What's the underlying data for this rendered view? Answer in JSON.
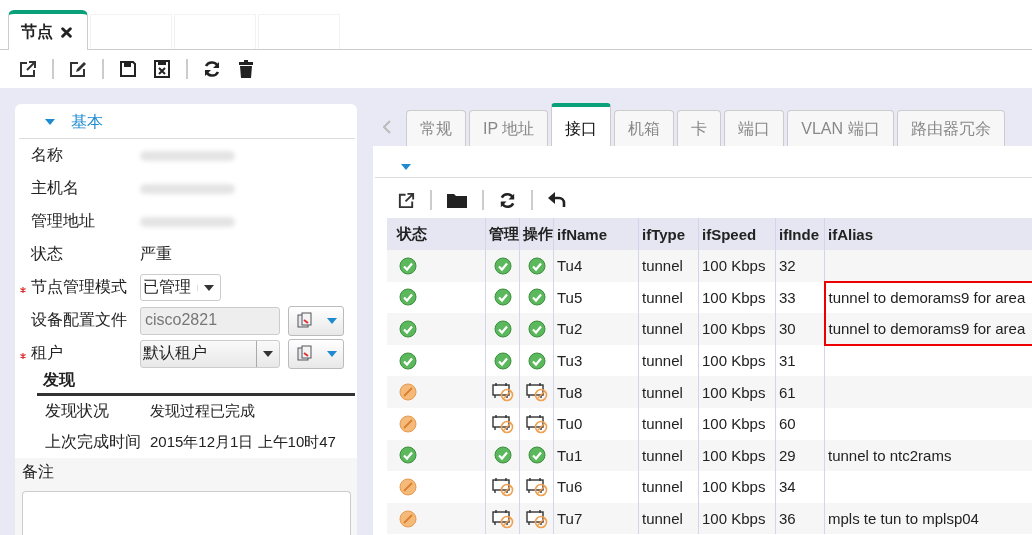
{
  "node_tab": {
    "label": "节点",
    "selected": true
  },
  "basic_section": {
    "title": "基本",
    "expanded": true
  },
  "fields": [
    {
      "kind": "redacted",
      "label": "名称",
      "required": false
    },
    {
      "kind": "redacted",
      "label": "主机名",
      "required": false
    },
    {
      "kind": "redacted",
      "label": "管理地址",
      "required": false
    },
    {
      "kind": "text",
      "label": "状态",
      "value": "严重",
      "required": false
    },
    {
      "kind": "select",
      "label": "节点管理模式",
      "value": "已管理",
      "required": true
    },
    {
      "kind": "input_menu",
      "label": "设备配置文件",
      "value": "cisco2821",
      "required": false
    },
    {
      "kind": "combo_menu",
      "label": "租户",
      "value": "默认租户",
      "required": true
    }
  ],
  "discovery": {
    "title": "发现",
    "fields": [
      {
        "label": "发现状况",
        "value": "发现过程已完成"
      },
      {
        "label": "上次完成时间",
        "value": "2015年12月1日 上午10时47"
      }
    ]
  },
  "notes": {
    "label": "备注"
  },
  "detail_tabs": [
    {
      "label": "常规",
      "selected": false
    },
    {
      "label": "IP 地址",
      "selected": false
    },
    {
      "label": "接口",
      "selected": true
    },
    {
      "label": "机箱",
      "selected": false
    },
    {
      "label": "卡",
      "selected": false
    },
    {
      "label": "端口",
      "selected": false
    },
    {
      "label": "VLAN 端口",
      "selected": false
    },
    {
      "label": "路由器冗余",
      "selected": false
    }
  ],
  "table": {
    "columns": [
      "状态",
      "管理",
      "操作",
      "ifName",
      "ifType",
      "ifSpeed",
      "ifInde",
      "ifAlias"
    ],
    "rows": [
      {
        "icons": [
          {
            "kind": "ok"
          },
          {
            "kind": "ok"
          },
          {
            "kind": "ok"
          }
        ],
        "ifName": "Tu4",
        "ifType": "tunnel",
        "ifSpeed": "100 Kbps",
        "ifIndex": "32",
        "flagged": false
      },
      {
        "icons": [
          {
            "kind": "ok"
          },
          {
            "kind": "ok"
          },
          {
            "kind": "ok"
          }
        ],
        "ifName": "Tu5",
        "ifType": "tunnel",
        "ifSpeed": "100 Kbps",
        "ifIndex": "33",
        "ifAlias": "tunnel to demorams9 for area",
        "flagged": true
      },
      {
        "icons": [
          {
            "kind": "ok"
          },
          {
            "kind": "ok"
          },
          {
            "kind": "ok"
          }
        ],
        "ifName": "Tu2",
        "ifType": "tunnel",
        "ifSpeed": "100 Kbps",
        "ifIndex": "30",
        "ifAlias": "tunnel to demorams9 for area",
        "flagged": true
      },
      {
        "icons": [
          {
            "kind": "ok"
          },
          {
            "kind": "ok"
          },
          {
            "kind": "ok"
          }
        ],
        "ifName": "Tu3",
        "ifType": "tunnel",
        "ifSpeed": "100 Kbps",
        "ifIndex": "31",
        "flagged": false
      },
      {
        "icons": [
          {
            "kind": "disabled"
          },
          {
            "kind": "disabled_device"
          },
          {
            "kind": "disabled_device"
          }
        ],
        "ifName": "Tu8",
        "ifType": "tunnel",
        "ifSpeed": "100 Kbps",
        "ifIndex": "61",
        "flagged": false
      },
      {
        "icons": [
          {
            "kind": "disabled"
          },
          {
            "kind": "disabled_device"
          },
          {
            "kind": "disabled_device"
          }
        ],
        "ifName": "Tu0",
        "ifType": "tunnel",
        "ifSpeed": "100 Kbps",
        "ifIndex": "60",
        "flagged": false
      },
      {
        "icons": [
          {
            "kind": "ok"
          },
          {
            "kind": "ok"
          },
          {
            "kind": "ok"
          }
        ],
        "ifName": "Tu1",
        "ifType": "tunnel",
        "ifSpeed": "100 Kbps",
        "ifIndex": "29",
        "ifAlias": "tunnel to ntc2rams",
        "flagged": false
      },
      {
        "icons": [
          {
            "kind": "disabled"
          },
          {
            "kind": "disabled_device"
          },
          {
            "kind": "disabled_device"
          }
        ],
        "ifName": "Tu6",
        "ifType": "tunnel",
        "ifSpeed": "100 Kbps",
        "ifIndex": "34",
        "flagged": false
      },
      {
        "icons": [
          {
            "kind": "disabled"
          },
          {
            "kind": "disabled_device"
          },
          {
            "kind": "disabled_device"
          }
        ],
        "ifName": "Tu7",
        "ifType": "tunnel",
        "ifSpeed": "100 Kbps",
        "ifIndex": "36",
        "ifAlias": "mpls te tun to mplsp04",
        "flagged": false
      }
    ]
  }
}
